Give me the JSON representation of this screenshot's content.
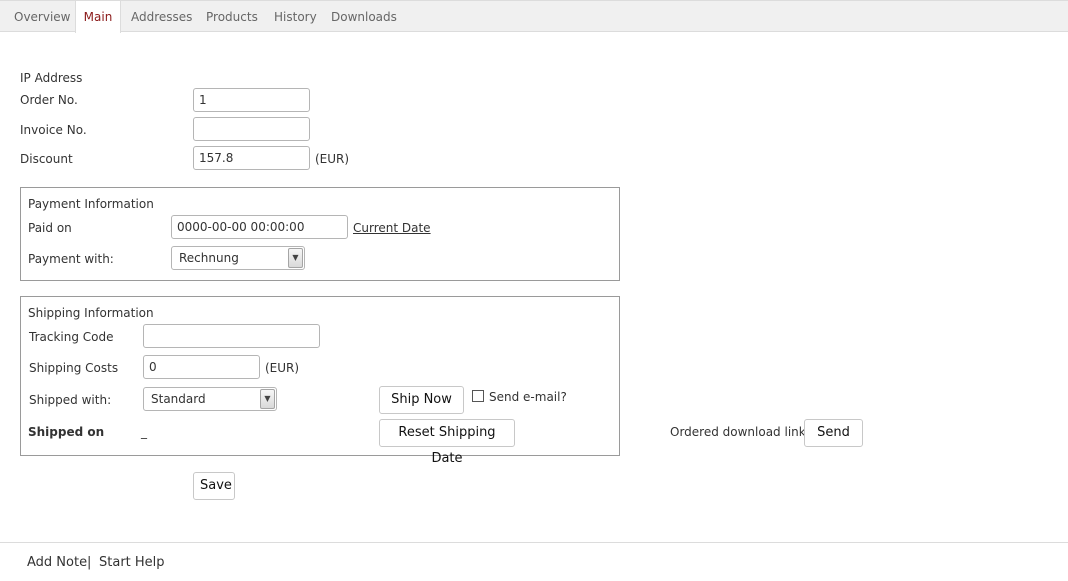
{
  "tabs": [
    {
      "label": "Overview"
    },
    {
      "label": "Main"
    },
    {
      "label": "Addresses"
    },
    {
      "label": "Products"
    },
    {
      "label": "History"
    },
    {
      "label": "Downloads"
    }
  ],
  "form": {
    "ip_address_label": "IP Address",
    "order_no_label": "Order No.",
    "order_no_value": "1",
    "invoice_no_label": "Invoice No.",
    "invoice_no_value": "",
    "discount_label": "Discount",
    "discount_value": "157.8",
    "discount_unit": "(EUR)"
  },
  "payment": {
    "title": "Payment Information",
    "paid_on_label": "Paid on",
    "paid_on_value": "0000-00-00 00:00:00",
    "current_date_link": "Current Date",
    "payment_with_label": "Payment with:",
    "payment_with_value": "Rechnung"
  },
  "shipping": {
    "title": "Shipping Information",
    "tracking_code_label": "Tracking Code",
    "tracking_code_value": "",
    "shipping_costs_label": "Shipping Costs",
    "shipping_costs_value": "0",
    "shipping_costs_unit": "(EUR)",
    "shipped_with_label": "Shipped with:",
    "shipped_with_value": "Standard",
    "ship_now_label": "Ship Now",
    "send_email_label": "Send e-mail?",
    "shipped_on_label": "Shipped on",
    "shipped_on_value": "_",
    "reset_shipping_label": "Reset Shipping Date"
  },
  "downloads": {
    "ordered_links_label": "Ordered download links",
    "send_label": "Send"
  },
  "save_label": "Save",
  "footer": {
    "add_note": "Add Note",
    "separator": "|",
    "start_help": "Start Help"
  }
}
